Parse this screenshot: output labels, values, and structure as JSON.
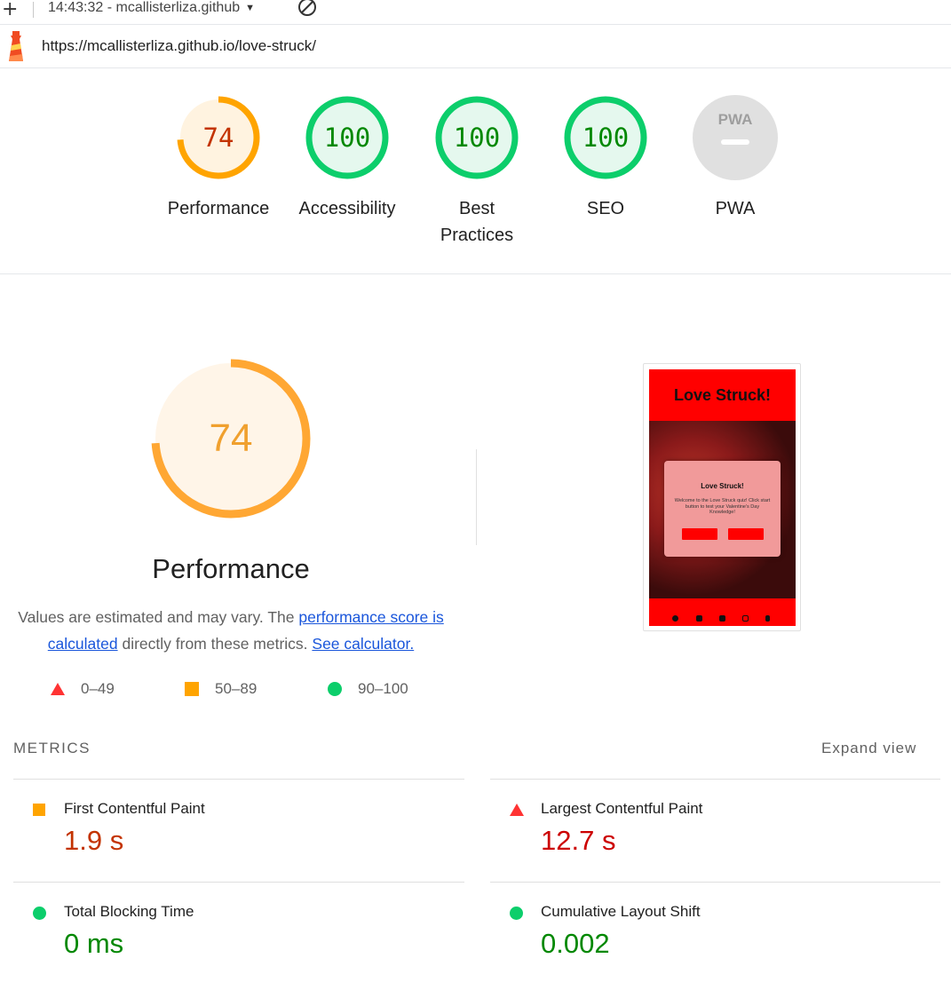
{
  "toolbar": {
    "plus_glyph": "+",
    "report_label": "14:43:32 - mcallisterliza.github",
    "caret": "▼"
  },
  "url": "https://mcallisterliza.github.io/love-struck/",
  "gauges": [
    {
      "label": "Performance",
      "score": "74",
      "level": 0.74,
      "color": "#ffa400",
      "fill": "#fff3e0",
      "text_color": "#c33300"
    },
    {
      "label": "Accessibility",
      "score": "100",
      "level": 1.0,
      "color": "#0cce6b",
      "fill": "#e5f8ee",
      "text_color": "#008800"
    },
    {
      "label": "Best Practices",
      "label_lines": [
        "Best",
        "Practices"
      ],
      "score": "100",
      "level": 1.0,
      "color": "#0cce6b",
      "fill": "#e5f8ee",
      "text_color": "#008800"
    },
    {
      "label": "SEO",
      "score": "100",
      "level": 1.0,
      "color": "#0cce6b",
      "fill": "#e5f8ee",
      "text_color": "#008800"
    },
    {
      "label": "PWA",
      "badge": "PWA",
      "color": "#e0e0e0",
      "fill": "#e0e0e0"
    }
  ],
  "performance": {
    "score": "74",
    "level": 0.74,
    "title": "Performance",
    "desc_prefix": "Values are estimated and may vary. The ",
    "desc_link1": "performance score is calculated",
    "desc_middle": " directly from these metrics. ",
    "desc_link2": "See calculator."
  },
  "legend": [
    {
      "shape": "triangle",
      "range": "0–49",
      "color": "#ff3333"
    },
    {
      "shape": "square",
      "range": "50–89",
      "color": "#ffa400"
    },
    {
      "shape": "circle",
      "range": "90–100",
      "color": "#0cce6b"
    }
  ],
  "screenshot": {
    "header_title": "Love Struck!",
    "modal_title": "Love Struck!",
    "modal_text": "Welcome to the Love Struck quiz! Click start button to test your Valentine's Day Knowledge!"
  },
  "metrics": {
    "title": "METRICS",
    "expand_label": "Expand view",
    "items": [
      {
        "label": "First Contentful Paint",
        "value": "1.9 s",
        "shape": "square",
        "color": "#ffa400",
        "value_color": "#c33300"
      },
      {
        "label": "Largest Contentful Paint",
        "value": "12.7 s",
        "shape": "triangle",
        "color": "#ff3333",
        "value_color": "#cc0000"
      },
      {
        "label": "Total Blocking Time",
        "value": "0 ms",
        "shape": "circle",
        "color": "#0cce6b",
        "value_color": "#008800"
      },
      {
        "label": "Cumulative Layout Shift",
        "value": "0.002",
        "shape": "circle",
        "color": "#0cce6b",
        "value_color": "#008800"
      }
    ]
  }
}
